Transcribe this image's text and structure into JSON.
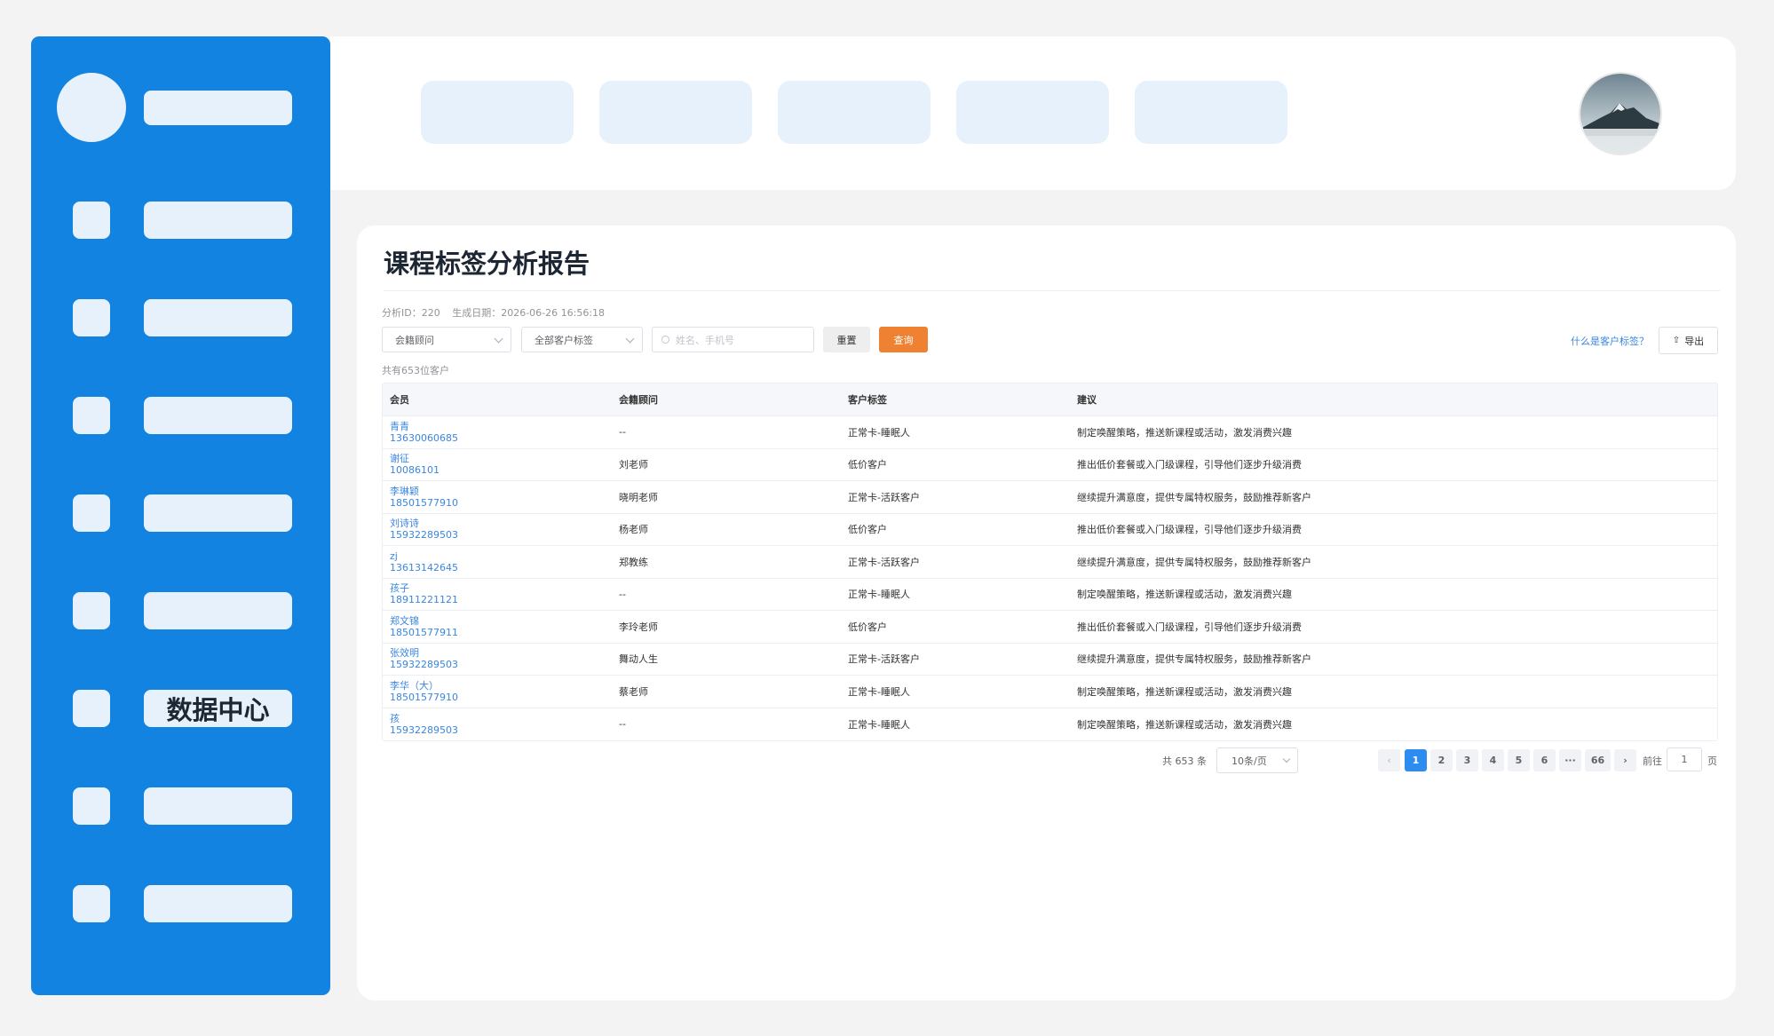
{
  "sidebar": {
    "items": [
      {
        "label": ""
      },
      {
        "label": ""
      },
      {
        "label": ""
      },
      {
        "label": ""
      },
      {
        "label": ""
      },
      {
        "label": "数据中心"
      },
      {
        "label": ""
      },
      {
        "label": ""
      }
    ],
    "active_label": "数据中心"
  },
  "topbar": {
    "tabs": [
      "",
      "",
      "",
      "",
      ""
    ]
  },
  "page": {
    "title": "课程标签分析报告",
    "meta_id": "分析ID：220",
    "meta_date": "生成日期：2026-06-26 16:56:18"
  },
  "filters": {
    "consultant_select": "会籍顾问",
    "tag_select": "全部客户标签",
    "search_placeholder": "姓名、手机号",
    "reset_label": "重置",
    "query_label": "查询",
    "help_link": "什么是客户标签？",
    "export_label": "导出"
  },
  "summary": {
    "total_customers": "共有653位客户"
  },
  "table": {
    "headers": [
      "会员",
      "会籍顾问",
      "客户标签",
      "建议"
    ],
    "rows": [
      {
        "name": "青青",
        "phone": "13630060685",
        "consultant": "--",
        "tag": "正常卡-睡眠人",
        "advice": "制定唤醒策略，推送新课程或活动，激发消费兴趣"
      },
      {
        "name": "谢征",
        "phone": "10086101",
        "consultant": "刘老师",
        "tag": "低价客户",
        "advice": "推出低价套餐或入门级课程，引导他们逐步升级消费"
      },
      {
        "name": "李琳颖",
        "phone": "18501577910",
        "consultant": "晓明老师",
        "tag": "正常卡-活跃客户",
        "advice": "继续提升满意度，提供专属特权服务，鼓励推荐新客户"
      },
      {
        "name": "刘诗诗",
        "phone": "15932289503",
        "consultant": "杨老师",
        "tag": "低价客户",
        "advice": "推出低价套餐或入门级课程，引导他们逐步升级消费"
      },
      {
        "name": "zj",
        "phone": "13613142645",
        "consultant": "郑教练",
        "tag": "正常卡-活跃客户",
        "advice": "继续提升满意度，提供专属特权服务，鼓励推荐新客户"
      },
      {
        "name": "孩子",
        "phone": "18911221121",
        "consultant": "--",
        "tag": "正常卡-睡眠人",
        "advice": "制定唤醒策略，推送新课程或活动，激发消费兴趣"
      },
      {
        "name": "郑文锦",
        "phone": "18501577911",
        "consultant": "李玲老师",
        "tag": "低价客户",
        "advice": "推出低价套餐或入门级课程，引导他们逐步升级消费"
      },
      {
        "name": "张效明",
        "phone": "15932289503",
        "consultant": "舞动人生",
        "tag": "正常卡-活跃客户",
        "advice": "继续提升满意度，提供专属特权服务，鼓励推荐新客户"
      },
      {
        "name": "李华（大）",
        "phone": "18501577910",
        "consultant": "蔡老师",
        "tag": "正常卡-睡眠人",
        "advice": "制定唤醒策略，推送新课程或活动，激发消费兴趣"
      },
      {
        "name": "孩",
        "phone": "15932289503",
        "consultant": "--",
        "tag": "正常卡-睡眠人",
        "advice": "制定唤醒策略，推送新课程或活动，激发消费兴趣"
      }
    ]
  },
  "pagination": {
    "total": "共 653 条",
    "page_size": "10条/页",
    "prev": "‹",
    "pages": [
      "1",
      "2",
      "3",
      "4",
      "5",
      "6",
      "···",
      "66"
    ],
    "next": "›",
    "current": "1",
    "goto_label": "前往",
    "goto_value": "1",
    "goto_suffix": "页"
  },
  "colors": {
    "sidebar_bg": "#1283e0",
    "placeholder_fill": "#e6f1fb",
    "query_button": "#ee8232",
    "link": "#3a86e0",
    "active_page": "#2d8cf0"
  },
  "icons": {
    "search": "magnifier-icon",
    "export": "upload-icon",
    "dropdown": "chevron-down-icon"
  }
}
